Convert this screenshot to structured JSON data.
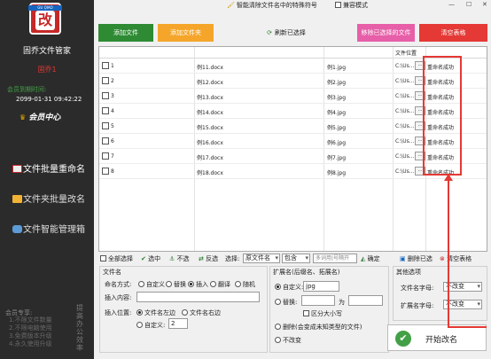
{
  "app": {
    "name": "固乔文件管家",
    "user": "固乔1",
    "expire_label": "会员到期时间:",
    "expire_date": "2099-01-31 09:42:22",
    "member_label": "会员中心",
    "nav": [
      "文件批量重命名",
      "文件夹批量改名",
      "文件智能管理箱"
    ],
    "promo_label": "会员专享:",
    "promo_lines": [
      "1.不限文件数量",
      "2.不限电脑使用",
      "3.免费版本升级",
      "4.永久使用升级"
    ],
    "promo_vertical": "提高办公效率"
  },
  "topbar": {
    "smart_clear": "智能清除文件名中的特殊符号",
    "compat_mode": "兼容模式"
  },
  "buttons": {
    "add_file": "添加文件",
    "add_folder": "添加文件夹",
    "refresh": "刷新已选择",
    "remove_selected": "移除已选择的文件",
    "clear_table": "清空表格"
  },
  "table": {
    "header_location": "文件位置",
    "rows": [
      {
        "num": "1",
        "orig": "例11.docx",
        "newn": "例1.jpg",
        "loc": "C:\\Us...",
        "status": "重命名成功"
      },
      {
        "num": "2",
        "orig": "例12.docx",
        "newn": "例2.jpg",
        "loc": "C:\\Us...",
        "status": "重命名成功"
      },
      {
        "num": "3",
        "orig": "例13.docx",
        "newn": "例3.jpg",
        "loc": "C:\\Us...",
        "status": "重命名成功"
      },
      {
        "num": "4",
        "orig": "例14.docx",
        "newn": "例4.jpg",
        "loc": "C:\\Us...",
        "status": "重命名成功"
      },
      {
        "num": "5",
        "orig": "例15.docx",
        "newn": "例5.jpg",
        "loc": "C:\\Us...",
        "status": "重命名成功"
      },
      {
        "num": "6",
        "orig": "例16.docx",
        "newn": "例6.jpg",
        "loc": "C:\\Us...",
        "status": "重命名成功"
      },
      {
        "num": "7",
        "orig": "例17.docx",
        "newn": "例7.jpg",
        "loc": "C:\\Us...",
        "status": "重命名成功"
      },
      {
        "num": "8",
        "orig": "例18.docx",
        "newn": "例8.jpg",
        "loc": "C:\\Us...",
        "status": "重命名成功"
      }
    ]
  },
  "toolbar2": {
    "select_all": "全部选择",
    "select": "选中",
    "deselect": "不选",
    "invert": "反选",
    "choose_label": "选择:",
    "choose_value": "原文件名",
    "contains_value": "包含",
    "multi_placeholder": "多词用|号隔开",
    "confirm": "确定",
    "delete_selected": "删除已选",
    "clear_table": "清空表格"
  },
  "filename_panel": {
    "title": "文件名",
    "mode_label": "命名方式:",
    "modes": [
      "自定义",
      "替换",
      "插入",
      "翻译",
      "随机"
    ],
    "insert_content_label": "插入内容:",
    "insert_pos_label": "插入位置:",
    "pos_options": [
      "文件名左边",
      "文件名右边",
      "自定义:"
    ],
    "custom_pos_value": "2"
  },
  "ext_panel": {
    "title": "扩展名(后缀名、拓展名)",
    "custom_label": "自定义:",
    "custom_value": "jpg",
    "replace_label": "替换:",
    "as_label": "为",
    "case_label": "区分大小写",
    "delete_label": "删除(会变成未知类型的文件)",
    "no_change_label": "不改变"
  },
  "other_panel": {
    "title": "其他选项",
    "fname_case_label": "文件名字母:",
    "fname_case_value": "不改变",
    "ext_case_label": "扩展名字母:",
    "ext_case_value": "不改变"
  },
  "start": "开始改名"
}
